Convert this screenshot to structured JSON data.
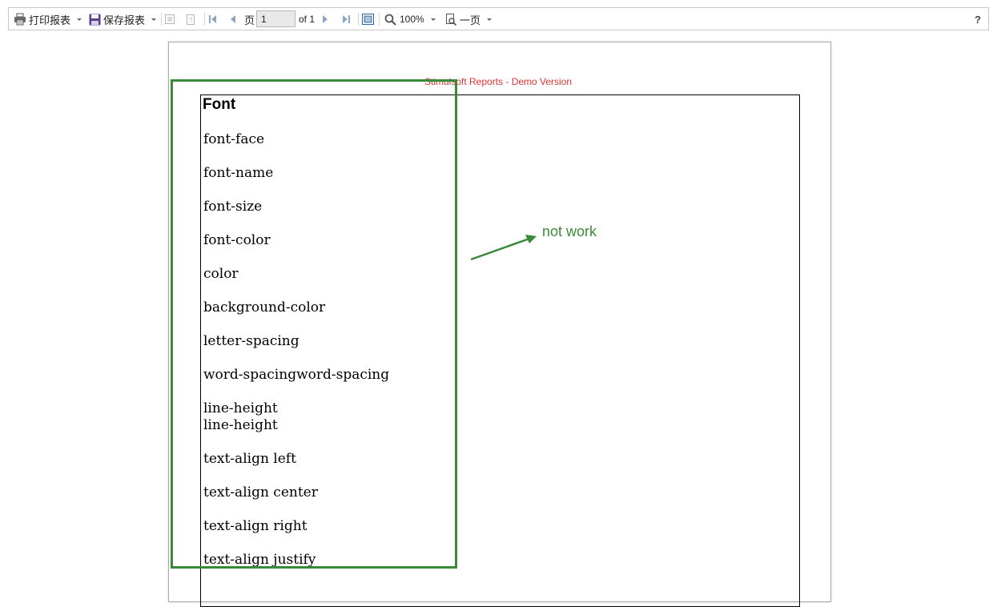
{
  "toolbar": {
    "print_label": "打印报表",
    "save_label": "保存报表",
    "page_label": "页",
    "page_value": "1",
    "of_label": "of 1",
    "zoom_label": "100%",
    "view_mode_label": "一页",
    "help_label": "?"
  },
  "report": {
    "watermark": "Stimulsoft Reports - Demo Version",
    "heading": "Font",
    "properties": [
      "font-face",
      "font-name",
      "font-size",
      "font-color",
      "color",
      "background-color",
      "letter-spacing",
      "word-spacingword-spacing",
      "line-height",
      "line-height",
      "text-align left",
      "text-align center",
      "text-align right",
      "text-align justify"
    ]
  },
  "annotation": {
    "text": "not work",
    "color": "#3a8a3a"
  },
  "colors": {
    "watermark": "#e03333",
    "annotation": "#3a8a3a",
    "save_icon": "#5c3f8f"
  }
}
